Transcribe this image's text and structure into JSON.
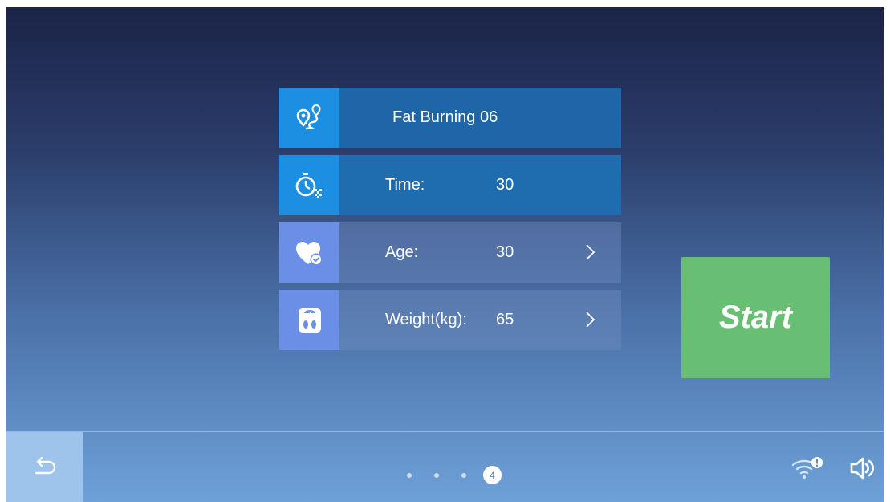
{
  "program": {
    "title": "Fat Burning 06",
    "icon": "route-pin-icon"
  },
  "fields": [
    {
      "label": "Time:",
      "value": "30",
      "icon": "stopwatch-flag-icon",
      "editable": false
    },
    {
      "label": "Age:",
      "value": "30",
      "icon": "heart-check-icon",
      "editable": true
    },
    {
      "label": "Weight(kg):",
      "value": "65",
      "icon": "scale-icon",
      "editable": true
    }
  ],
  "start_label": "Start",
  "pagination": {
    "current": "4",
    "total_dots": 4
  },
  "colors": {
    "accent_blue": "#1d8fe3",
    "start_green": "#68bf74",
    "lavender": "#6b8fe6"
  },
  "bottom": {
    "back_icon": "back-arrow-icon",
    "wifi_icon": "wifi-warning-icon",
    "volume_icon": "speaker-icon"
  }
}
